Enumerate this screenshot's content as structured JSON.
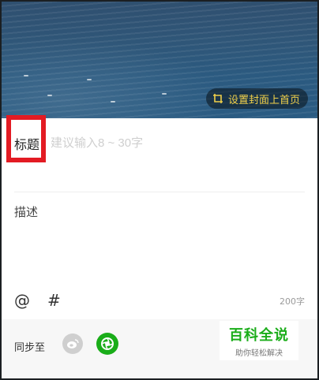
{
  "cover": {
    "set_cover_label": "设置封面上首页",
    "accent_color": "#f0d04a"
  },
  "title": {
    "label": "标题",
    "placeholder": "建议输入8 ~ 30字",
    "highlight_color": "#e31b23"
  },
  "description": {
    "label": "描述"
  },
  "tools": {
    "mention_icon": "@",
    "hashtag_icon": "#",
    "char_count": "200字"
  },
  "sync": {
    "label": "同步至",
    "targets": [
      "weibo-icon",
      "moments-icon"
    ],
    "moments_color": "#1aad19"
  },
  "watermark": {
    "title": "百科全说",
    "subtitle": "助你轻松解决"
  }
}
